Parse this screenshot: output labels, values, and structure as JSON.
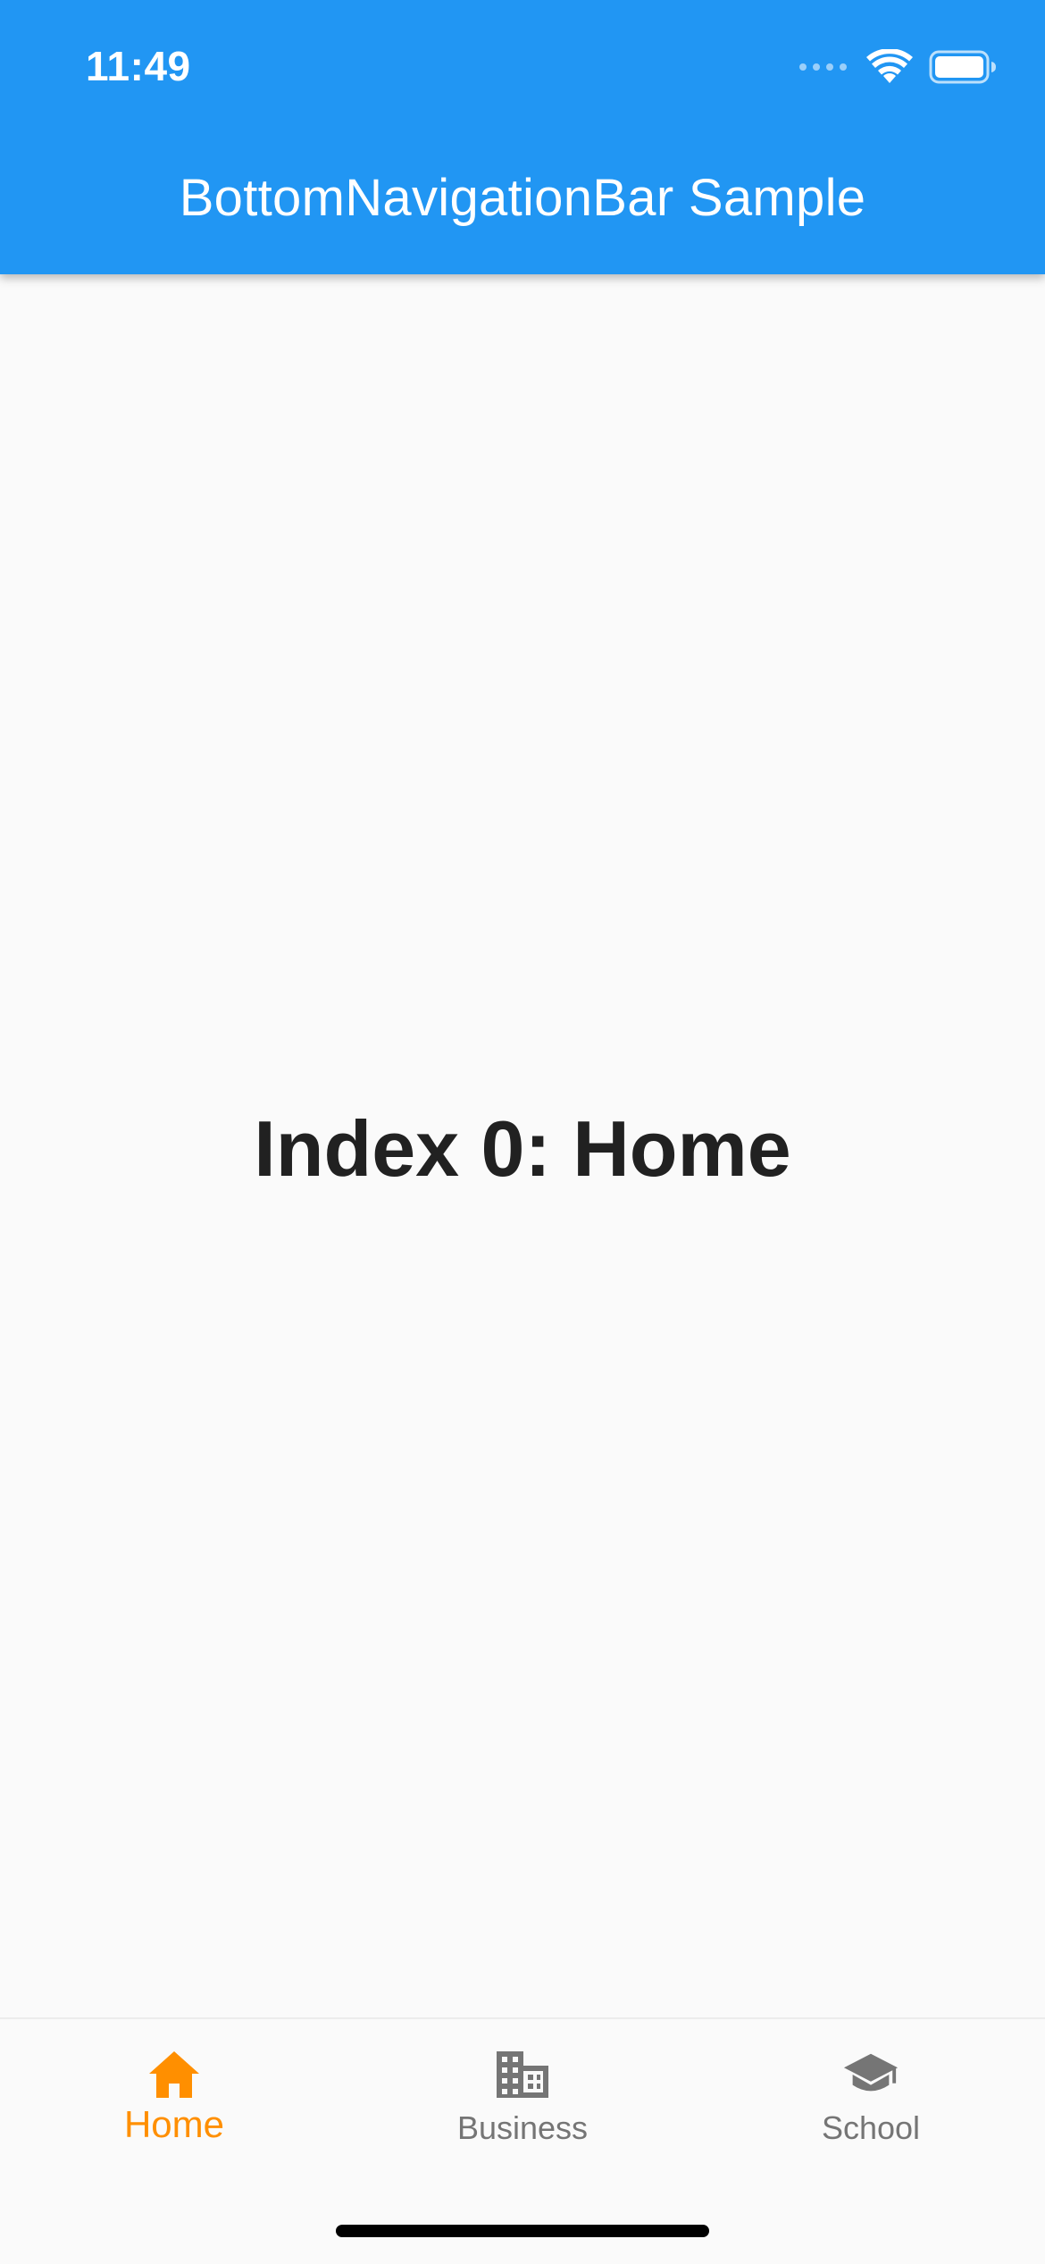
{
  "status_bar": {
    "time": "11:49",
    "icons": [
      "signal-dots-icon",
      "wifi-icon",
      "battery-icon"
    ]
  },
  "app_bar": {
    "title": "BottomNavigationBar Sample",
    "background_color": "#2196f3"
  },
  "content": {
    "text": "Index 0: Home"
  },
  "bottom_nav": {
    "selected_index": 0,
    "selected_color": "#ff8f00",
    "unselected_color": "#757575",
    "items": [
      {
        "label": "Home",
        "icon": "home-icon"
      },
      {
        "label": "Business",
        "icon": "business-icon"
      },
      {
        "label": "School",
        "icon": "school-icon"
      }
    ]
  }
}
